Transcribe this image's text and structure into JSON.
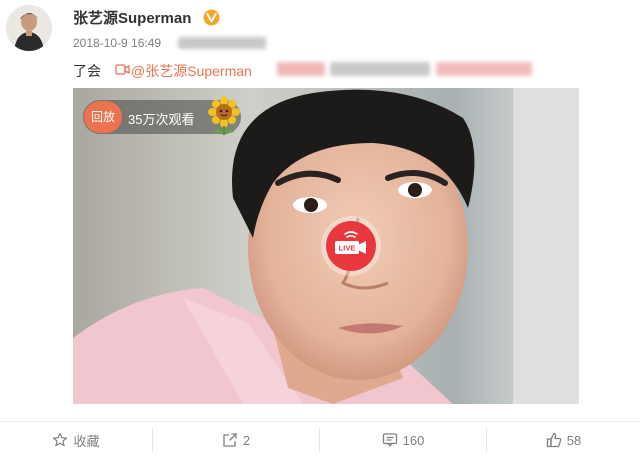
{
  "post": {
    "author": "张艺源Superman",
    "verified_badge_icon": "verified-v-icon",
    "timestamp": "2018-10-9 16:49",
    "text": "了会",
    "mention": "@张艺源Superman",
    "link_icon": "live-link-icon"
  },
  "video": {
    "replay_label": "回放",
    "view_count": "35万次观看",
    "emoji_icon": "sunflower-emoji-icon",
    "live_badge": "LIVE"
  },
  "actions": {
    "favorite": {
      "label": "收藏",
      "icon": "star-outline-icon"
    },
    "forward": {
      "label": "2",
      "icon": "share-icon"
    },
    "comment": {
      "label": "160",
      "icon": "comment-icon"
    },
    "like": {
      "label": "58",
      "icon": "thumbs-up-icon"
    }
  },
  "colors": {
    "accent": "#eb7350",
    "verified": "#f5a623",
    "live_red": "#e8383d",
    "muted_text": "#808080"
  }
}
